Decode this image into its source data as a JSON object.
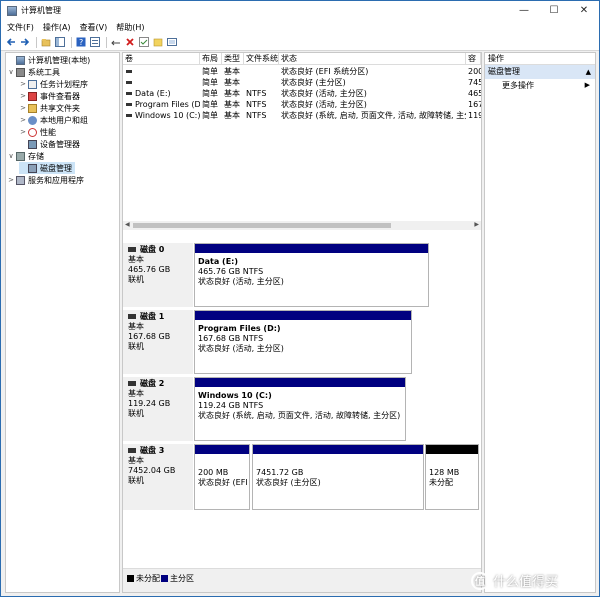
{
  "window": {
    "title": "计算机管理",
    "controls": {
      "minimize": "—",
      "maximize": "☐",
      "close": "✕"
    }
  },
  "menu": [
    "文件(F)",
    "操作(A)",
    "查看(V)",
    "帮助(H)"
  ],
  "toolbar": {
    "icons": [
      "back-arrow-icon",
      "forward-arrow-icon",
      "up-folder-icon",
      "show-hide-tree-icon",
      "help-icon",
      "properties-icon",
      "connect-icon",
      "delete-icon",
      "check-icon",
      "folder-yellow-icon",
      "rescan-icon"
    ]
  },
  "tree": {
    "items": [
      {
        "label": "计算机管理(本地)",
        "level": 0,
        "arrow": "",
        "icon": "computer-management-icon"
      },
      {
        "label": "系统工具",
        "level": 1,
        "arrow": "∨",
        "icon": "tools-icon"
      },
      {
        "label": "任务计划程序",
        "level": 2,
        "arrow": ">",
        "icon": "task-scheduler-icon"
      },
      {
        "label": "事件查看器",
        "level": 2,
        "arrow": ">",
        "icon": "event-viewer-icon"
      },
      {
        "label": "共享文件夹",
        "level": 2,
        "arrow": ">",
        "icon": "shared-folder-icon"
      },
      {
        "label": "本地用户和组",
        "level": 2,
        "arrow": ">",
        "icon": "users-icon"
      },
      {
        "label": "性能",
        "level": 2,
        "arrow": ">",
        "icon": "performance-icon"
      },
      {
        "label": "设备管理器",
        "level": 2,
        "arrow": "",
        "icon": "device-manager-icon"
      },
      {
        "label": "存储",
        "level": 1,
        "arrow": "∨",
        "icon": "storage-icon"
      },
      {
        "label": "磁盘管理",
        "level": 2,
        "arrow": "",
        "icon": "disk-management-icon",
        "selected": true
      },
      {
        "label": "服务和应用程序",
        "level": 1,
        "arrow": ">",
        "icon": "services-icon"
      }
    ]
  },
  "volumes": {
    "headers": [
      "卷",
      "布局",
      "类型",
      "文件系统",
      "状态",
      "容"
    ],
    "rows": [
      {
        "name": "",
        "layout": "简单",
        "type": "基本",
        "fs": "",
        "status": "状态良好 (EFI 系统分区)",
        "cap": "200"
      },
      {
        "name": "",
        "layout": "简单",
        "type": "基本",
        "fs": "",
        "status": "状态良好 (主分区)",
        "cap": "745"
      },
      {
        "name": "Data (E:)",
        "layout": "简单",
        "type": "基本",
        "fs": "NTFS",
        "status": "状态良好 (活动, 主分区)",
        "cap": "465"
      },
      {
        "name": "Program Files (D:)",
        "layout": "简单",
        "type": "基本",
        "fs": "NTFS",
        "status": "状态良好 (活动, 主分区)",
        "cap": "167"
      },
      {
        "name": "Windows 10 (C:)",
        "layout": "简单",
        "type": "基本",
        "fs": "NTFS",
        "status": "状态良好 (系统, 启动, 页面文件, 活动, 故障转储, 主分区)",
        "cap": "119"
      }
    ]
  },
  "disks": [
    {
      "name": "磁盘 0",
      "type": "基本",
      "size": "465.76 GB",
      "status": "联机",
      "partitions": [
        {
          "title": "Data  (E:)",
          "size": "465.76 GB NTFS",
          "status": "状态良好 (活动, 主分区)",
          "color": "#000080"
        }
      ]
    },
    {
      "name": "磁盘 1",
      "type": "基本",
      "size": "167.68 GB",
      "status": "联机",
      "partitions": [
        {
          "title": "Program Files  (D:)",
          "size": "167.68 GB NTFS",
          "status": "状态良好 (活动, 主分区)",
          "color": "#000080"
        }
      ]
    },
    {
      "name": "磁盘 2",
      "type": "基本",
      "size": "119.24 GB",
      "status": "联机",
      "partitions": [
        {
          "title": "Windows 10  (C:)",
          "size": "119.24 GB NTFS",
          "status": "状态良好 (系统, 启动, 页面文件, 活动, 故障转储, 主分区)",
          "color": "#000080"
        }
      ]
    },
    {
      "name": "磁盘 3",
      "type": "基本",
      "size": "7452.04 GB",
      "status": "联机",
      "partitions": [
        {
          "title": "",
          "size": "200 MB",
          "status": "状态良好 (EFI 3",
          "color": "#000080"
        },
        {
          "title": "",
          "size": "7451.72 GB",
          "status": "状态良好 (主分区)",
          "color": "#000080"
        },
        {
          "title": "",
          "size": "128 MB",
          "status": "未分配",
          "color": "#000000"
        }
      ]
    }
  ],
  "legend": [
    {
      "label": "未分配",
      "color": "#000000"
    },
    {
      "label": "主分区",
      "color": "#000080"
    }
  ],
  "actions": {
    "title": "操作",
    "section": "磁盘管理",
    "more": "更多操作"
  },
  "watermark": {
    "text": "什么值得买",
    "icon_text": "值"
  }
}
